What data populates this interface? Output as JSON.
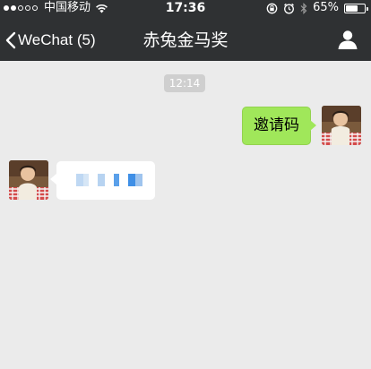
{
  "status_bar": {
    "carrier": "中国移动",
    "time": "17:36",
    "battery_percent": "65%",
    "battery_level": 0.65,
    "signal_bars_filled": 2,
    "signal_bars_total": 5,
    "icons": [
      "wifi-icon",
      "orientation-lock-icon",
      "alarm-icon",
      "bluetooth-icon",
      "battery-icon"
    ]
  },
  "nav": {
    "back_label": "WeChat (5)",
    "title": "赤兔金马奖",
    "back_icon": "chevron-left-icon",
    "profile_icon": "person-icon"
  },
  "chat": {
    "timestamp": "12:14",
    "messages": [
      {
        "sender": "me",
        "text": "邀请码"
      },
      {
        "sender": "other",
        "text": "",
        "note_redacted": true
      }
    ]
  },
  "colors": {
    "header_bg": "#2f3133",
    "chat_bg": "#ebebeb",
    "sent_bubble": "#a0e75a",
    "received_bubble": "#ffffff",
    "timestamp_bg": "#cfcfcf"
  }
}
